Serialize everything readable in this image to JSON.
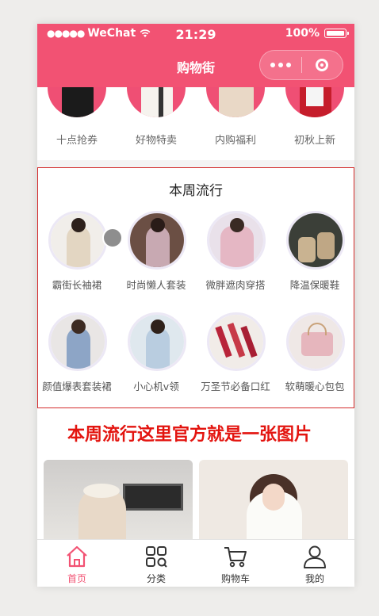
{
  "status_bar": {
    "carrier": "WeChat",
    "signal_dots": "●●●●●",
    "time": "21:29",
    "battery": "100%"
  },
  "nav": {
    "title": "购物街",
    "capsule_more_icon": "more-dots-icon",
    "capsule_close_icon": "target-close-icon"
  },
  "categories": [
    {
      "label": "十点抢券"
    },
    {
      "label": "好物特卖"
    },
    {
      "label": "内购福利"
    },
    {
      "label": "初秋上新"
    }
  ],
  "weekly": {
    "title": "本周流行",
    "items": [
      {
        "label": "霸街长袖裙"
      },
      {
        "label": "时尚懒人套装"
      },
      {
        "label": "微胖遮肉穿搭"
      },
      {
        "label": "降温保暖鞋"
      },
      {
        "label": "颜值爆表套装裙"
      },
      {
        "label": "小心机v领"
      },
      {
        "label": "万圣节必备口红"
      },
      {
        "label": "软萌暖心包包"
      }
    ]
  },
  "annotation": {
    "text": "本周流行这里官方就是一张图片"
  },
  "tabbar": {
    "tabs": [
      {
        "label": "首页",
        "icon": "home-icon",
        "active": true
      },
      {
        "label": "分类",
        "icon": "category-grid-icon",
        "active": false
      },
      {
        "label": "购物车",
        "icon": "cart-icon",
        "active": false
      },
      {
        "label": "我的",
        "icon": "user-icon",
        "active": false
      }
    ]
  },
  "colors": {
    "brand": "#f25273",
    "annotation_red": "#e3140f",
    "box_outline": "#d32b2b"
  }
}
